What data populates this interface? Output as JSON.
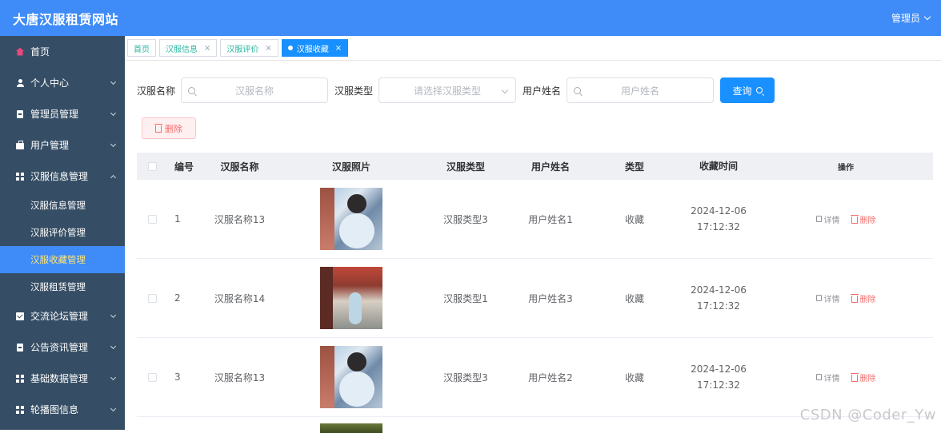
{
  "header": {
    "title": "大唐汉服租赁网站",
    "user": "管理员"
  },
  "sidebar": {
    "items": [
      {
        "label": "首页",
        "icon": "home-icon"
      },
      {
        "label": "个人中心",
        "icon": "person-icon"
      },
      {
        "label": "管理员管理",
        "icon": "clipboard-icon"
      },
      {
        "label": "用户管理",
        "icon": "bag-icon"
      },
      {
        "label": "汉服信息管理",
        "icon": "grid-icon"
      }
    ],
    "sub_items": [
      "汉服信息管理",
      "汉服评价管理",
      "汉服收藏管理",
      "汉服租赁管理"
    ],
    "more_items": [
      {
        "label": "交流论坛管理",
        "icon": "check-icon"
      },
      {
        "label": "公告资讯管理",
        "icon": "clipboard-icon"
      },
      {
        "label": "基础数据管理",
        "icon": "grid-icon"
      },
      {
        "label": "轮播图信息",
        "icon": "grid-icon"
      }
    ]
  },
  "tabs": [
    "首页",
    "汉服信息",
    "汉服评价",
    "汉服收藏"
  ],
  "search": {
    "name_label": "汉服名称",
    "name_placeholder": "汉服名称",
    "type_label": "汉服类型",
    "type_placeholder": "请选择汉服类型",
    "user_label": "用户姓名",
    "user_placeholder": "用户姓名",
    "query_button": "查询"
  },
  "delete_button": "删除",
  "table": {
    "headers": [
      "编号",
      "汉服名称",
      "汉服照片",
      "汉服类型",
      "用户姓名",
      "类型",
      "收藏时间",
      "操作"
    ],
    "rows": [
      {
        "no": "1",
        "name": "汉服名称13",
        "type": "汉服类型3",
        "user": "用户姓名1",
        "kind": "收藏",
        "time": "2024-12-06 17:12:32"
      },
      {
        "no": "2",
        "name": "汉服名称14",
        "type": "汉服类型1",
        "user": "用户姓名3",
        "kind": "收藏",
        "time": "2024-12-06 17:12:32"
      },
      {
        "no": "3",
        "name": "汉服名称13",
        "type": "汉服类型3",
        "user": "用户姓名2",
        "kind": "收藏",
        "time": "2024-12-06 17:12:32"
      }
    ],
    "op_detail": "详情",
    "op_delete": "删除"
  },
  "watermark": "CSDN @Coder_Yw",
  "colors": {
    "header": "#3f8bf7",
    "sidebar": "#364e65",
    "active": "#3f8bf7",
    "primary": "#1890ff",
    "danger": "#f56c6c"
  }
}
